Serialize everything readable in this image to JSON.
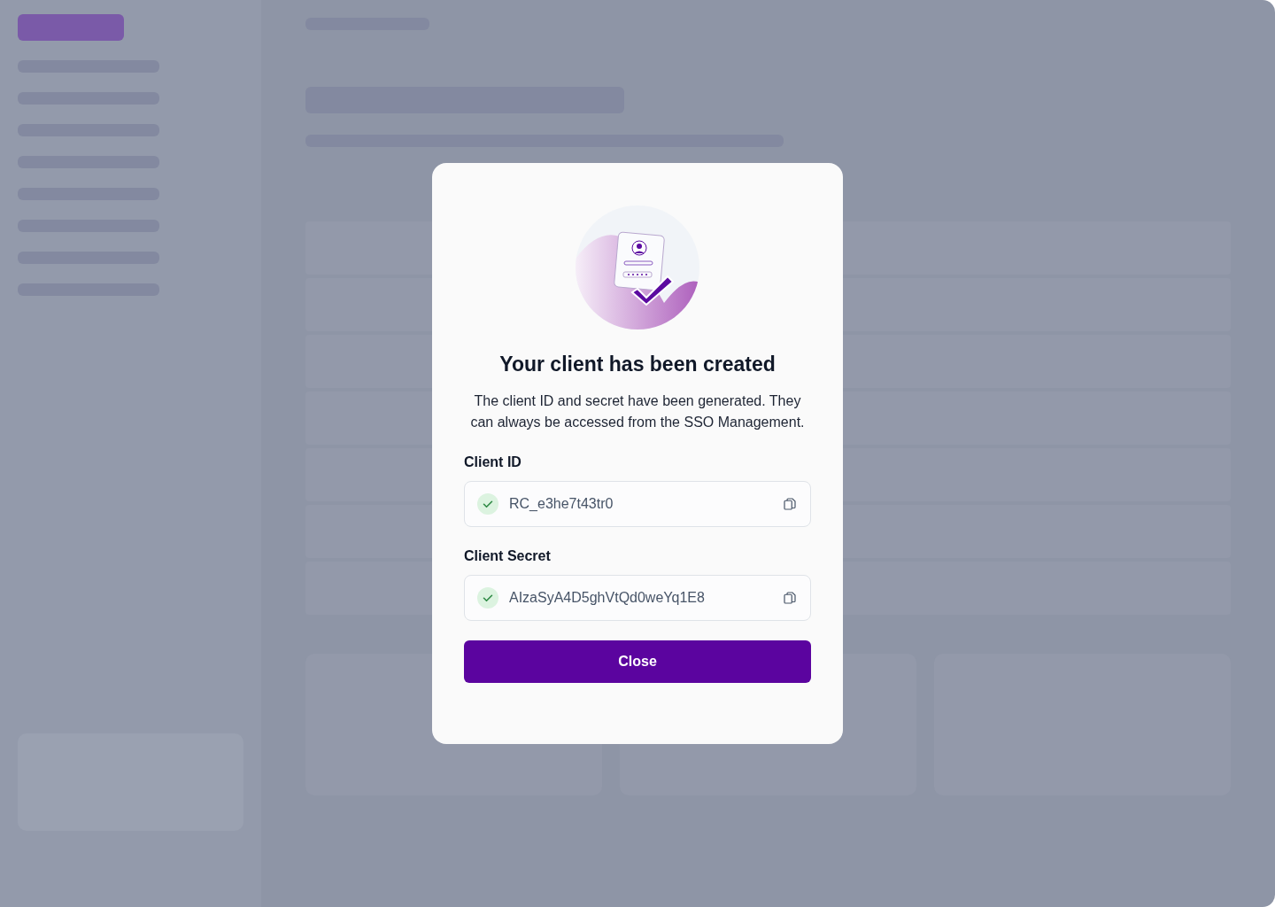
{
  "dialog": {
    "title": "Your client has been created",
    "message": "The client ID and secret have been generated. They can always be accessed from the SSO Management.",
    "fields": [
      {
        "label": "Client ID",
        "value": "RC_e3he7t43tr0",
        "verified": true
      },
      {
        "label": "Client Secret",
        "value": "AIzaSyA4D5ghVtQd0weYq1E8",
        "verified": true
      }
    ],
    "button": "Close"
  }
}
